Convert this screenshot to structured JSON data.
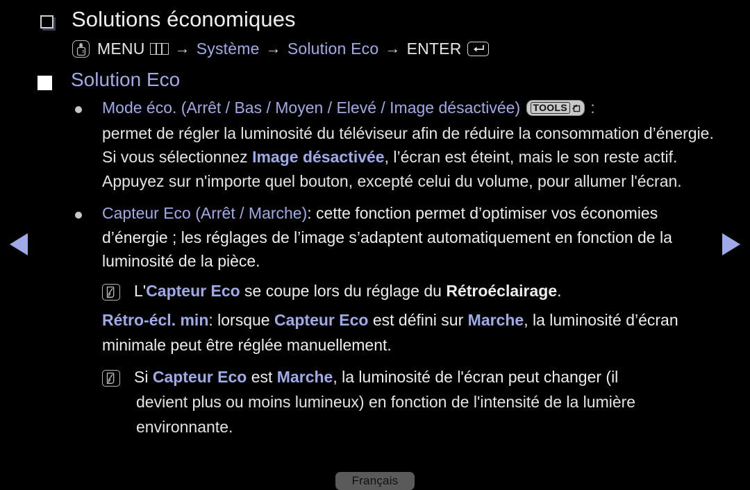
{
  "page": {
    "title": "Solutions économiques",
    "language_button": "Français"
  },
  "breadcrumb": {
    "menu_label": "MENU",
    "sep": "→",
    "step_system": "Système",
    "step_solution_eco": "Solution Eco",
    "enter_label": "ENTER",
    "menu_icon": "hand-press-icon",
    "grid_icon": "menu-grid-icon",
    "enter_icon": "enter-return-icon"
  },
  "section": {
    "heading": "Solution Eco"
  },
  "bullets": [
    {
      "title": "Mode éco. (Arrêt / Bas / Moyen / Elevé / Image désactivée)",
      "badge": "TOOLS",
      "colon": ":",
      "body_1": "permet de régler la luminosité du téléviseur afin de réduire la consommation d’énergie. Si vous sélectionnez ",
      "highlight_1": "Image désactivée",
      "body_2": ", l’écran est éteint, mais le son reste actif. Appuyez sur n'importe quel bouton, excepté celui du volume, pour allumer l'écran."
    },
    {
      "title": "Capteur Eco (Arrêt / Marche)",
      "body_1": ": cette fonction permet d’optimiser vos économies d’énergie ; les réglages de l’image s’adaptent automatiquement en fonction de la luminosité de la pièce."
    }
  ],
  "notes": [
    {
      "icon": "note-icon",
      "prefix": "L'",
      "highlight_1": "Capteur Eco",
      "middle": " se coupe lors du réglage du ",
      "highlight_2": "Rétroéclairage",
      "suffix": "."
    },
    {
      "label": "Rétro-écl. min",
      "text_1": ": lorsque ",
      "highlight_1": "Capteur Eco",
      "text_2": " est défini sur ",
      "highlight_2": "Marche",
      "text_3": ", la luminosité d’écran minimale peut être réglée manuellement."
    },
    {
      "icon": "note-icon",
      "prefix": "Si ",
      "highlight_1": "Capteur Eco",
      "middle": " est ",
      "highlight_2": "Marche",
      "suffix": ", la luminosité de l'écran peut changer (il",
      "continuation": "devient plus ou moins lumineux) en fonction de l'intensité de la lumière environnante."
    }
  ],
  "nav": {
    "prev": "prev-page-arrow",
    "next": "next-page-arrow"
  },
  "colors": {
    "background": "#000000",
    "accent": "#9fabe8",
    "text": "#e8e8e8",
    "badge_bg": "#c9c9c9",
    "lang_bg": "#5a5a5a"
  }
}
